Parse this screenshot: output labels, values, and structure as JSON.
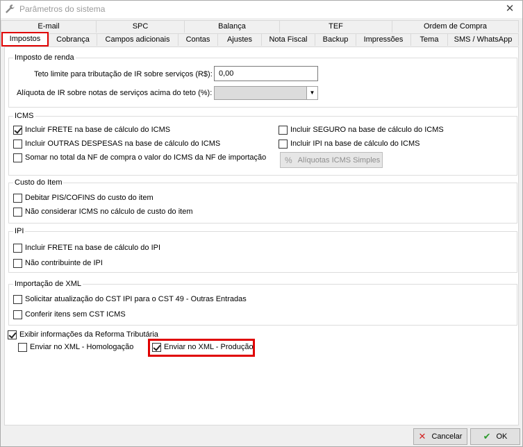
{
  "window": {
    "title": "Parâmetros do sistema",
    "close_glyph": "✕"
  },
  "tabs_row1": [
    "E-mail",
    "SPC",
    "Balança",
    "TEF",
    "Ordem de Compra"
  ],
  "tabs_row2": [
    "Impostos",
    "Cobrança",
    "Campos adicionais",
    "Contas",
    "Ajustes",
    "Nota Fiscal",
    "Backup",
    "Impressões",
    "Tema",
    "SMS / WhatsApp"
  ],
  "active_tab": "Impostos",
  "imposto_renda": {
    "title": "Imposto de renda",
    "teto_label": "Teto limite para tributação de IR sobre serviços (R$):",
    "teto_value": "0,00",
    "aliquota_label": "Alíquota de IR sobre notas de serviços acima do teto (%):",
    "aliquota_value": ""
  },
  "icms": {
    "title": "ICMS",
    "items": [
      {
        "label": "Incluir FRETE na base de cálculo do ICMS",
        "checked": true
      },
      {
        "label": "Incluir OUTRAS DESPESAS na base de cálculo do ICMS",
        "checked": false
      },
      {
        "label": "Somar no total da NF de compra o valor do ICMS da NF de importação",
        "checked": false
      },
      {
        "label": "Incluir SEGURO na base de cálculo do ICMS",
        "checked": false
      },
      {
        "label": "Incluir IPI na base de cálculo do ICMS",
        "checked": false
      }
    ],
    "button_label": "Alíquotas ICMS Simples",
    "button_icon": "percent-icon"
  },
  "custo_item": {
    "title": "Custo do Item",
    "items": [
      {
        "label": "Debitar PIS/COFINS do custo do item",
        "checked": false
      },
      {
        "label": "Não considerar ICMS no cálculo de custo do item",
        "checked": false
      }
    ]
  },
  "ipi": {
    "title": "IPI",
    "items": [
      {
        "label": "Incluir FRETE na base de cálculo do IPI",
        "checked": false
      },
      {
        "label": "Não contribuinte de IPI",
        "checked": false
      }
    ]
  },
  "importacao_xml": {
    "title": "Importação de XML",
    "items": [
      {
        "label": "Solicitar atualização do CST IPI para o CST 49 - Outras Entradas",
        "checked": false
      },
      {
        "label": "Conferir itens sem CST ICMS",
        "checked": false
      }
    ]
  },
  "reforma": {
    "label": "Exibir informações da Reforma Tributária",
    "checked": true,
    "homologacao": {
      "label": "Enviar no XML - Homologação",
      "checked": false
    },
    "producao": {
      "label": "Enviar no XML - Produção",
      "checked": true
    }
  },
  "footer": {
    "cancel_label": "Cancelar",
    "ok_label": "OK"
  },
  "colors": {
    "highlight": "#e00000",
    "cancel_icon": "#d21f1f",
    "ok_icon": "#2e9b2e"
  }
}
